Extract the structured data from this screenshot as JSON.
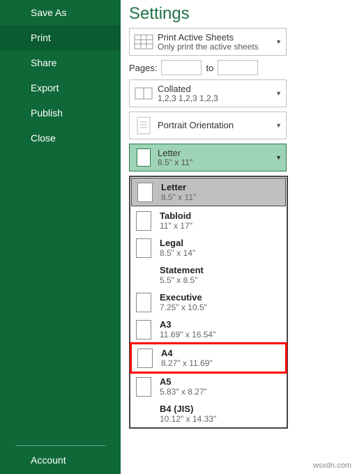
{
  "sidebar": {
    "items": [
      {
        "label": "Save As"
      },
      {
        "label": "Print"
      },
      {
        "label": "Share"
      },
      {
        "label": "Export"
      },
      {
        "label": "Publish"
      },
      {
        "label": "Close"
      }
    ],
    "bottom": {
      "label": "Account"
    }
  },
  "settings": {
    "title": "Settings",
    "print_what": {
      "title": "Print Active Sheets",
      "sub": "Only print the active sheets"
    },
    "pages": {
      "label": "Pages:",
      "to": "to"
    },
    "collation": {
      "title": "Collated",
      "sub": "1,2,3    1,2,3    1,2,3"
    },
    "orientation": {
      "title": "Portrait Orientation"
    },
    "paper": {
      "title": "Letter",
      "sub": "8.5\" x 11\""
    }
  },
  "paper_sizes": [
    {
      "name": "Letter",
      "dim": "8.5\" x 11\"",
      "icon": true,
      "current": true,
      "highlight": false
    },
    {
      "name": "Tabloid",
      "dim": "11\" x 17\"",
      "icon": true,
      "current": false,
      "highlight": false
    },
    {
      "name": "Legal",
      "dim": "8.5\" x 14\"",
      "icon": true,
      "current": false,
      "highlight": false
    },
    {
      "name": "Statement",
      "dim": "5.5\" x 8.5\"",
      "icon": false,
      "current": false,
      "highlight": false
    },
    {
      "name": "Executive",
      "dim": "7.25\" x 10.5\"",
      "icon": true,
      "current": false,
      "highlight": false
    },
    {
      "name": "A3",
      "dim": "11.69\" x 16.54\"",
      "icon": true,
      "current": false,
      "highlight": false
    },
    {
      "name": "A4",
      "dim": "8.27\" x 11.69\"",
      "icon": true,
      "current": false,
      "highlight": true
    },
    {
      "name": "A5",
      "dim": "5.83\" x 8.27\"",
      "icon": true,
      "current": false,
      "highlight": false
    },
    {
      "name": "B4 (JIS)",
      "dim": "10.12\" x 14.33\"",
      "icon": false,
      "current": false,
      "highlight": false
    }
  ],
  "watermark": "wsxdn.com"
}
